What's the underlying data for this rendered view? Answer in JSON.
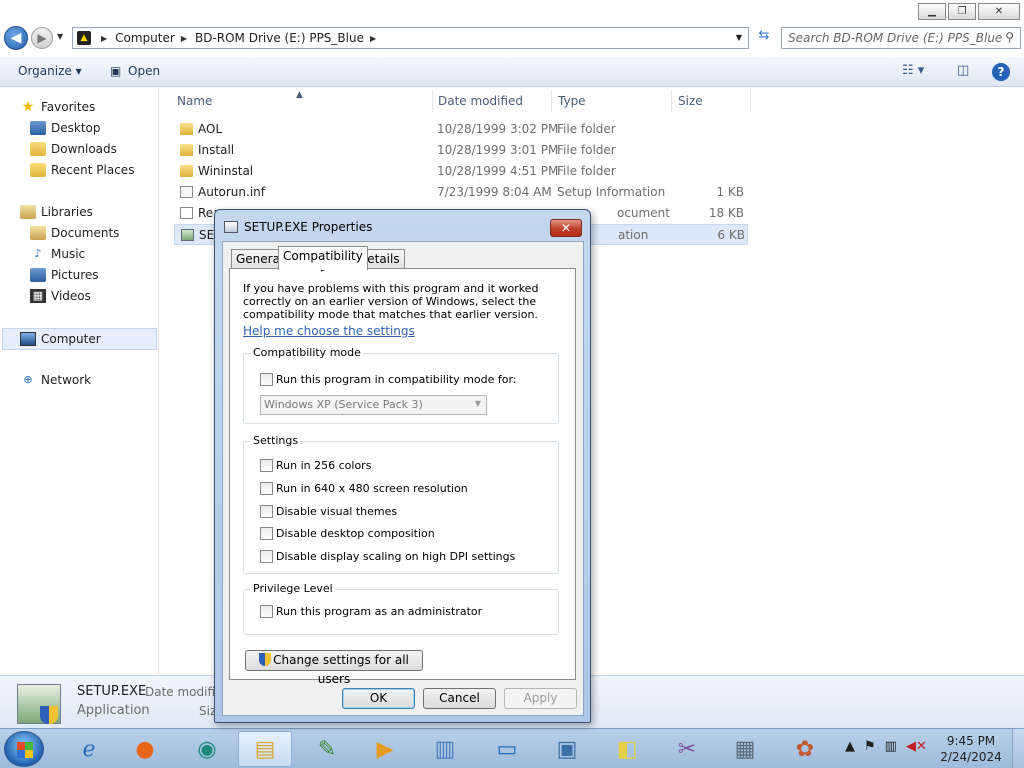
{
  "window": {
    "minimize": "▁",
    "maximize": "❐",
    "close": "✕"
  },
  "address": {
    "crumbs": [
      "Computer",
      "BD-ROM Drive (E:) PPS_Blue"
    ],
    "search_placeholder": "Search BD-ROM Drive (E:) PPS_Blue"
  },
  "toolbar": {
    "organize": "Organize ▾",
    "open": "Open"
  },
  "nav": {
    "favorites": "Favorites",
    "desktop": "Desktop",
    "downloads": "Downloads",
    "recent": "Recent Places",
    "libraries": "Libraries",
    "documents": "Documents",
    "music": "Music",
    "pictures": "Pictures",
    "videos": "Videos",
    "computer": "Computer",
    "network": "Network"
  },
  "columns": {
    "name": "Name",
    "date": "Date modified",
    "type": "Type",
    "size": "Size"
  },
  "files": [
    {
      "name": "AOL",
      "date": "10/28/1999 3:02 PM",
      "type": "File folder",
      "size": "",
      "icon": "folder-icon"
    },
    {
      "name": "Install",
      "date": "10/28/1999 3:01 PM",
      "type": "File folder",
      "size": "",
      "icon": "folder-icon"
    },
    {
      "name": "Wininstal",
      "date": "10/28/1999 4:51 PM",
      "type": "File folder",
      "size": "",
      "icon": "folder-icon"
    },
    {
      "name": "Autorun.inf",
      "date": "7/23/1999 8:04 AM",
      "type": "Setup Information",
      "size": "1 KB",
      "icon": "inf-file-icon"
    },
    {
      "name": "Rea",
      "date": "",
      "type": "ocument",
      "size": "18 KB",
      "icon": "document-icon"
    },
    {
      "name": "SET",
      "date": "",
      "type": "ation",
      "size": "6 KB",
      "icon": "exe-icon"
    }
  ],
  "details": {
    "name": "SETUP.EXE",
    "type": "Application",
    "label1": "Date modifie",
    "label2": "Siz"
  },
  "dialog": {
    "title": "SETUP.EXE Properties",
    "close": "✕",
    "tabs": [
      "General",
      "Compatibility",
      "Details"
    ],
    "intro": "If you have problems with this program and it worked correctly on an earlier version of Windows, select the compatibility mode that matches that earlier version.",
    "help_link": "Help me choose the settings",
    "compat_group": "Compatibility mode",
    "compat_checkbox": "Run this program in compatibility mode for:",
    "compat_select": "Windows XP (Service Pack 3)",
    "settings_group": "Settings",
    "settings": [
      "Run in 256 colors",
      "Run in 640 x 480 screen resolution",
      "Disable visual themes",
      "Disable desktop composition",
      "Disable display scaling on high DPI settings"
    ],
    "privilege_group": "Privilege Level",
    "admin_checkbox": "Run this program as an administrator",
    "change_all": "Change settings for all users",
    "ok": "OK",
    "cancel": "Cancel",
    "apply": "Apply"
  },
  "taskbar": {
    "time": "9:45 PM",
    "date": "2/24/2024"
  }
}
